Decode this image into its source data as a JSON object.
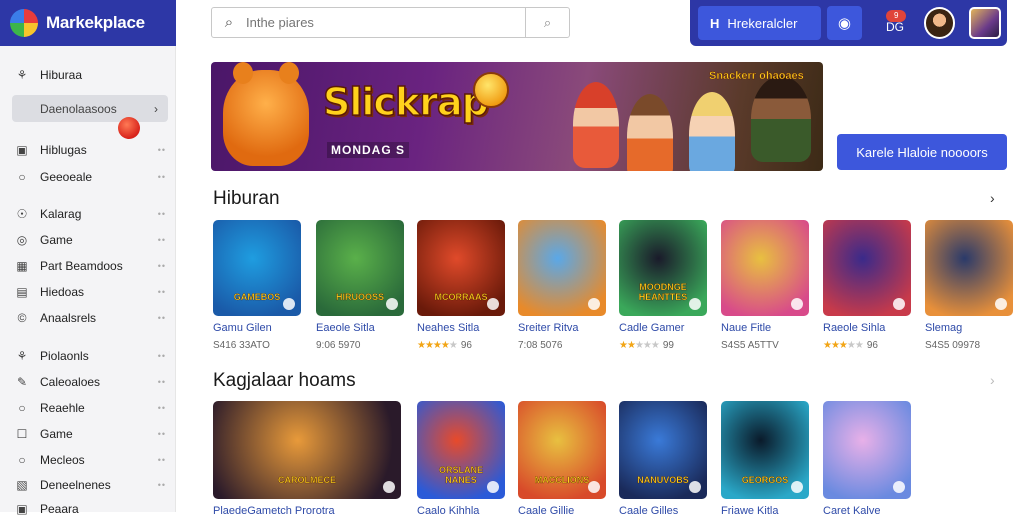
{
  "brand": {
    "title": "Markekplace"
  },
  "search": {
    "placeholder": "Inthe piares"
  },
  "topbar": {
    "main_label": "Hrekeralcler",
    "main_icon": "H",
    "notif_count": "9",
    "notif_label": "DG"
  },
  "sidebar": {
    "items": [
      {
        "label": "Hiburaa",
        "icon": "controller-icon"
      },
      {
        "label": "Hiblugas",
        "icon": "square-icon"
      },
      {
        "label": "Geeoeale",
        "icon": "circle-icon"
      },
      {
        "label": "Kalarag",
        "icon": "target-icon"
      },
      {
        "label": "Game",
        "icon": "gamepad-icon"
      },
      {
        "label": "Part Beamdoos",
        "icon": "grid-icon"
      },
      {
        "label": "Hiedoas",
        "icon": "list-icon"
      },
      {
        "label": "Anaalsrels",
        "icon": "copyright-icon"
      },
      {
        "label": "Piolaonls",
        "icon": "controller-icon"
      },
      {
        "label": "Caleoaloes",
        "icon": "pencil-icon"
      },
      {
        "label": "Reaehle",
        "icon": "circle-icon"
      },
      {
        "label": "Game",
        "icon": "chat-icon"
      },
      {
        "label": "Mecleos",
        "icon": "circle-icon"
      },
      {
        "label": "Deneelnenes",
        "icon": "image-icon"
      },
      {
        "label": "Peaara",
        "icon": "square-icon"
      }
    ],
    "selected": {
      "label": "Daenolaasoos"
    }
  },
  "banner": {
    "title": "Slickrap",
    "subtitle": "MONDAG S",
    "tag": "Snackerr ohaoaes"
  },
  "cta": {
    "label": "Karele Hlaloie noooors"
  },
  "section1": {
    "title": "Hiburan",
    "cards": [
      {
        "name": "Gamu Gilen",
        "meta": "S416 33ATO",
        "rating": null,
        "logo": "GAMEBOS",
        "colors": [
          "#1f9de0",
          "#1a5aa8"
        ]
      },
      {
        "name": "Eaeole Sitla",
        "meta": "9:06 5970",
        "rating": null,
        "logo": "HIRUOOSS",
        "colors": [
          "#5ab04a",
          "#2a6a3a"
        ]
      },
      {
        "name": "Neahes Sitla",
        "meta": "96",
        "rating": 4,
        "logo": "MCORRAAS",
        "colors": [
          "#e04a2a",
          "#6a1a0a"
        ]
      },
      {
        "name": "Sreiter Ritva",
        "meta": "7:08 5076",
        "rating": null,
        "logo": "",
        "colors": [
          "#5aa8e8",
          "#e88a2a"
        ]
      },
      {
        "name": "Cadle Gamer",
        "meta": "99",
        "rating": 2,
        "logo": "MOODNGE HEANTTES",
        "colors": [
          "#1a1a2a",
          "#3aa85a"
        ]
      },
      {
        "name": "Naue Fitle",
        "meta": "S4S5 A5TTV",
        "rating": null,
        "logo": "",
        "colors": [
          "#e8c040",
          "#d84a8a"
        ]
      },
      {
        "name": "Raeole Sihla",
        "meta": "96",
        "rating": 3,
        "logo": "",
        "colors": [
          "#3a2a8a",
          "#c83a4a"
        ]
      },
      {
        "name": "Slemag",
        "meta": "S4S5 09978",
        "rating": null,
        "logo": "",
        "colors": [
          "#2a3a6a",
          "#e8903a"
        ]
      }
    ]
  },
  "section2": {
    "title": "Kagjalaar hoams",
    "cards": [
      {
        "name": "PlaedeGametch Prorotra",
        "logo": "CAROLMECE",
        "colors": [
          "#e89a3a",
          "#2a1a2a"
        ]
      },
      {
        "name": "Caalo Kihhla",
        "logo": "ORSLANE NANES",
        "colors": [
          "#e84a2a",
          "#2a5ad8"
        ]
      },
      {
        "name": "Caale Gillie",
        "logo": "MACCLIONS",
        "colors": [
          "#e8c040",
          "#d84a2a"
        ]
      },
      {
        "name": "Caale Gilles",
        "logo": "NANUVOBS",
        "colors": [
          "#3a7ad8",
          "#1a2a5a"
        ]
      },
      {
        "name": "Friawe Kitla",
        "logo": "GEORGOS",
        "colors": [
          "#0a1a2a",
          "#2aa8c8"
        ]
      },
      {
        "name": "Caret Kalve",
        "logo": "",
        "colors": [
          "#e8b0e8",
          "#6a8ae0"
        ]
      }
    ]
  }
}
